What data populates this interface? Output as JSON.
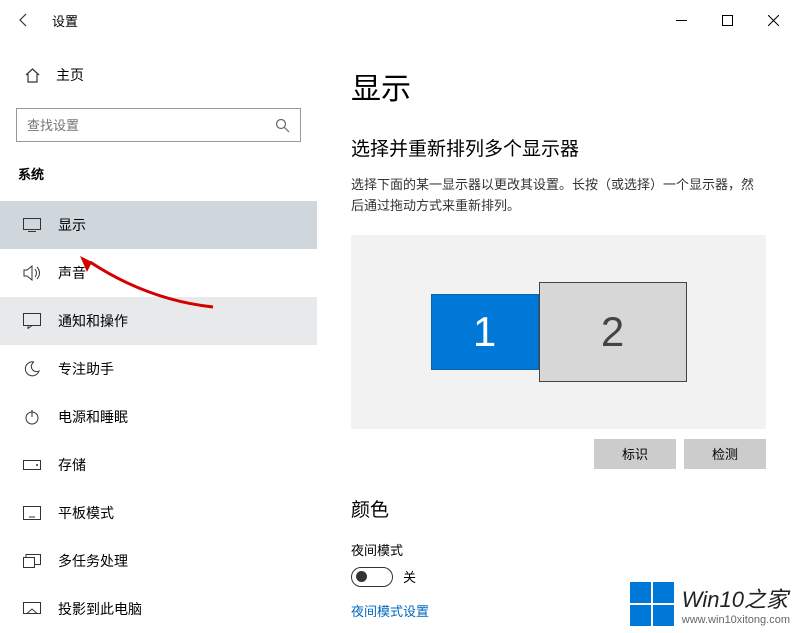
{
  "window": {
    "title": "设置"
  },
  "sidebar": {
    "home": "主页",
    "search_placeholder": "查找设置",
    "category": "系统",
    "items": [
      {
        "label": "显示"
      },
      {
        "label": "声音"
      },
      {
        "label": "通知和操作"
      },
      {
        "label": "专注助手"
      },
      {
        "label": "电源和睡眠"
      },
      {
        "label": "存储"
      },
      {
        "label": "平板模式"
      },
      {
        "label": "多任务处理"
      },
      {
        "label": "投影到此电脑"
      }
    ]
  },
  "main": {
    "heading": "显示",
    "arrange": {
      "title": "选择并重新排列多个显示器",
      "desc": "选择下面的某一显示器以更改其设置。长按（或选择）一个显示器，然后通过拖动方式来重新排列。",
      "monitors": [
        "1",
        "2"
      ],
      "identify_btn": "标识",
      "detect_btn": "检测"
    },
    "color": {
      "title": "颜色",
      "night_label": "夜间模式",
      "toggle_state": "关",
      "night_settings_link": "夜间模式设置"
    }
  },
  "watermark": {
    "title": "Win10之家",
    "url": "www.win10xitong.com"
  }
}
